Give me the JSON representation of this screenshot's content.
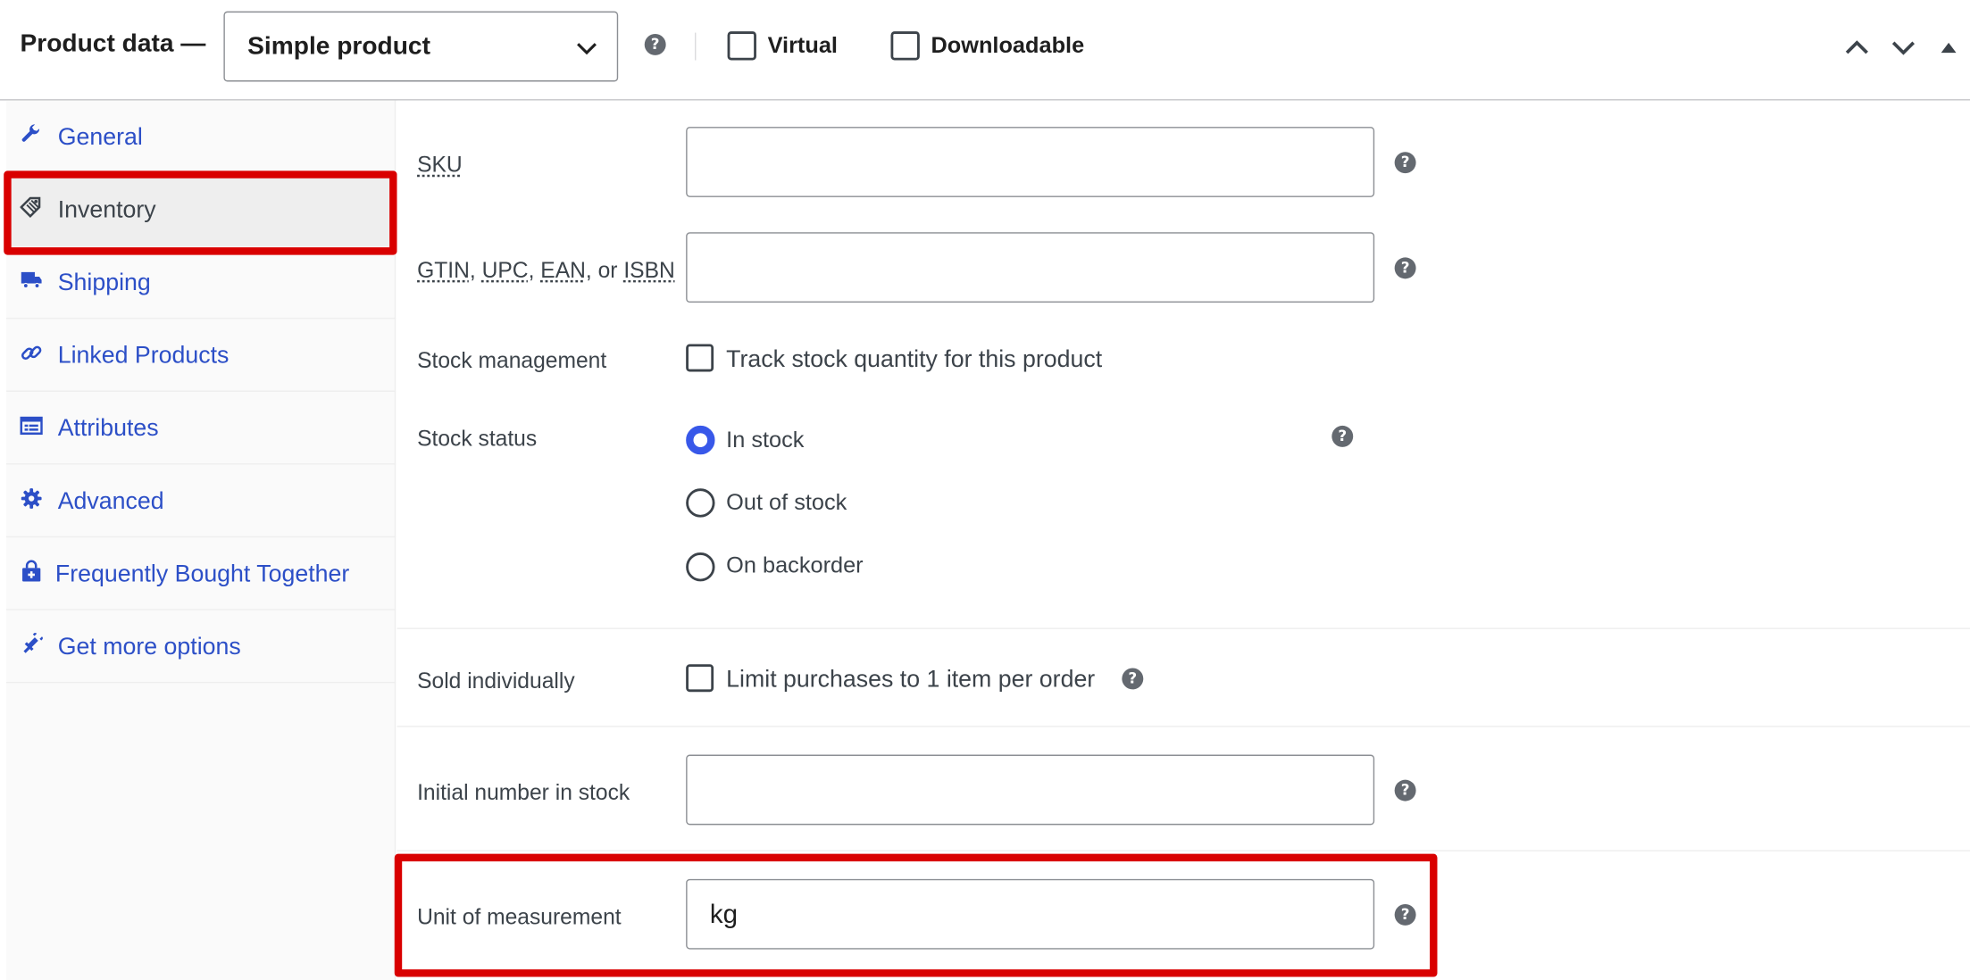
{
  "header": {
    "title": "Product data —",
    "product_type": "Simple product",
    "virtual_label": "Virtual",
    "downloadable_label": "Downloadable",
    "virtual_checked": false,
    "downloadable_checked": false
  },
  "tabs": [
    {
      "label": "General",
      "icon": "wrench-icon",
      "active": false
    },
    {
      "label": "Inventory",
      "icon": "tag-icon",
      "active": true
    },
    {
      "label": "Shipping",
      "icon": "truck-icon",
      "active": false
    },
    {
      "label": "Linked Products",
      "icon": "link-icon",
      "active": false
    },
    {
      "label": "Attributes",
      "icon": "list-icon",
      "active": false
    },
    {
      "label": "Advanced",
      "icon": "gear-icon",
      "active": false
    },
    {
      "label": "Frequently Bought Together",
      "icon": "bag-plus-icon",
      "active": false
    },
    {
      "label": "Get more options",
      "icon": "plugin-icon",
      "active": false
    }
  ],
  "inventory": {
    "sku_label": "SKU",
    "sku_value": "",
    "gtin_parts": [
      "GTIN",
      ", ",
      "UPC",
      ", ",
      "EAN",
      ", or ",
      "ISBN"
    ],
    "gtin_value": "",
    "stock_management_label": "Stock management",
    "stock_management_option": "Track stock quantity for this product",
    "stock_management_checked": false,
    "stock_status_label": "Stock status",
    "stock_status_options": [
      "In stock",
      "Out of stock",
      "On backorder"
    ],
    "stock_status_selected": "In stock",
    "sold_individually_label": "Sold individually",
    "sold_individually_option": "Limit purchases to 1 item per order",
    "sold_individually_checked": false,
    "initial_stock_label": "Initial number in stock",
    "initial_stock_value": "",
    "unit_label": "Unit of measurement",
    "unit_value": "kg"
  },
  "colors": {
    "link": "#2c4fc7",
    "radio_accent": "#3858e9",
    "highlight_box": "#d90000",
    "help_icon": "#646970"
  }
}
